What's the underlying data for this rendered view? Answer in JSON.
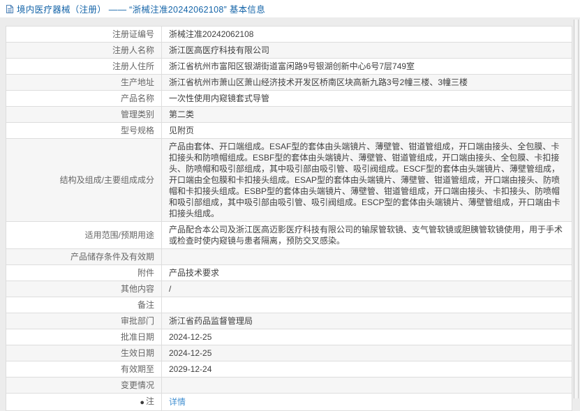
{
  "header": {
    "title": "境内医疗器械（注册） —— “浙械注准20242062108” 基本信息"
  },
  "colors": {
    "title_blue": "#1464a8",
    "link_blue": "#4491d2",
    "row_alt_bg": "#f6f6f6",
    "border": "#dddddd",
    "label_text": "#666666",
    "value_text": "#404040"
  },
  "table": {
    "rows": [
      {
        "label": "注册证编号",
        "value": "浙械注准20242062108"
      },
      {
        "label": "注册人名称",
        "value": "浙江医高医疗科技有限公司"
      },
      {
        "label": "注册人住所",
        "value": "浙江省杭州市富阳区银湖街道富闲路9号银湖创新中心6号7层749室"
      },
      {
        "label": "生产地址",
        "value": "浙江省杭州市萧山区萧山经济技术开发区桥南区块高新九路3号2幢三楼、3幢三楼"
      },
      {
        "label": "产品名称",
        "value": "一次性使用内窥镜套式导管"
      },
      {
        "label": "管理类别",
        "value": "第二类"
      },
      {
        "label": "型号规格",
        "value": "见附页"
      },
      {
        "label": "结构及组成/主要组成成分",
        "value": "产品由套体、开口端组成。ESAF型的套体由头端镜片、薄壁管、钳道管组成，开口端由接头、全包膜、卡扣接头和防喷帽组成。ESBF型的套体由头端镜片、薄壁管、钳道管组成，开口端由接头、全包膜、卡扣接头、防喷帽和吸引部组成，其中吸引部由吸引管、吸引阀组成。ESCF型的套体由头端镜片、薄壁管组成，开口端由全包膜和卡扣接头组成。ESAP型的套体由头端镜片、薄壁管、钳道管组成，开口端由接头、防喷帽和卡扣接头组成。ESBP型的套体由头端镜片、薄壁管、钳道管组成，开口端由接头、卡扣接头、防喷帽和吸引部组成，其中吸引部由吸引管、吸引阀组成。ESCP型的套体由头端镜片、薄壁管组成，开口端由卡扣接头组成。"
      },
      {
        "label": "适用范围/预期用途",
        "value": "产品配合本公司及浙江医高迈影医疗科技有限公司的输尿管软镜、支气管软镜或胆胰管软镜使用，用于手术或检查时使内窥镜与患者隔离，预防交叉感染。"
      },
      {
        "label": "产品储存条件及有效期",
        "value": ""
      },
      {
        "label": "附件",
        "value": "产品技术要求"
      },
      {
        "label": "其他内容",
        "value": "/"
      },
      {
        "label": "备注",
        "value": ""
      },
      {
        "label": "审批部门",
        "value": "浙江省药品监督管理局"
      },
      {
        "label": "批准日期",
        "value": "2024-12-25"
      },
      {
        "label": "生效日期",
        "value": "2024-12-25"
      },
      {
        "label": "有效期至",
        "value": "2029-12-24"
      },
      {
        "label": "变更情况",
        "value": ""
      },
      {
        "label": "注",
        "value": "详情",
        "link": true,
        "icon": "note-icon"
      }
    ]
  }
}
